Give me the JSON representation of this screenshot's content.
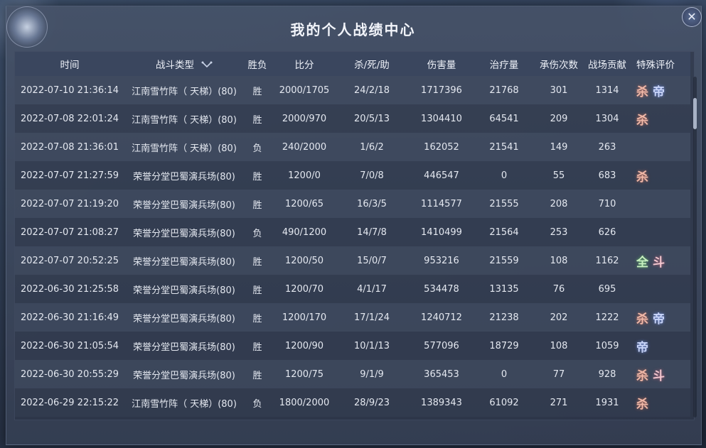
{
  "window": {
    "title": "我的个人战绩中心",
    "close_glyph": "✕"
  },
  "columns": [
    "时间",
    "战斗类型",
    "胜负",
    "比分",
    "杀/死/助",
    "伤害量",
    "治疗量",
    "承伤次数",
    "战场贡献",
    "特殊评价"
  ],
  "badge_labels": {
    "kill": "杀",
    "emperor": "帝",
    "all": "全",
    "fight": "斗"
  },
  "rows": [
    {
      "time": "2022-07-10 21:36:14",
      "type": "江南雪竹阵（ 天梯）(80)",
      "result": "胜",
      "score": "2000/1705",
      "kda": "24/2/18",
      "damage": "1717396",
      "heal": "21768",
      "hits": "301",
      "contrib": "1314",
      "badges": [
        "kill",
        "emperor"
      ]
    },
    {
      "time": "2022-07-08 22:01:24",
      "type": "江南雪竹阵（ 天梯）(80)",
      "result": "胜",
      "score": "2000/970",
      "kda": "20/5/13",
      "damage": "1304410",
      "heal": "64541",
      "hits": "209",
      "contrib": "1304",
      "badges": [
        "kill"
      ]
    },
    {
      "time": "2022-07-08 21:36:01",
      "type": "江南雪竹阵（ 天梯）(80)",
      "result": "负",
      "score": "240/2000",
      "kda": "1/6/2",
      "damage": "162052",
      "heal": "21541",
      "hits": "149",
      "contrib": "263",
      "badges": []
    },
    {
      "time": "2022-07-07 21:27:59",
      "type": "荣誉分堂巴蜀演兵场(80)",
      "result": "胜",
      "score": "1200/0",
      "kda": "7/0/8",
      "damage": "446547",
      "heal": "0",
      "hits": "55",
      "contrib": "683",
      "badges": [
        "kill"
      ]
    },
    {
      "time": "2022-07-07 21:19:20",
      "type": "荣誉分堂巴蜀演兵场(80)",
      "result": "胜",
      "score": "1200/65",
      "kda": "16/3/5",
      "damage": "1114577",
      "heal": "21555",
      "hits": "208",
      "contrib": "710",
      "badges": []
    },
    {
      "time": "2022-07-07 21:08:27",
      "type": "荣誉分堂巴蜀演兵场(80)",
      "result": "负",
      "score": "490/1200",
      "kda": "14/7/8",
      "damage": "1410499",
      "heal": "21564",
      "hits": "253",
      "contrib": "626",
      "badges": []
    },
    {
      "time": "2022-07-07 20:52:25",
      "type": "荣誉分堂巴蜀演兵场(80)",
      "result": "胜",
      "score": "1200/50",
      "kda": "15/0/7",
      "damage": "953216",
      "heal": "21559",
      "hits": "108",
      "contrib": "1162",
      "badges": [
        "all",
        "fight"
      ]
    },
    {
      "time": "2022-06-30 21:25:58",
      "type": "荣誉分堂巴蜀演兵场(80)",
      "result": "胜",
      "score": "1200/70",
      "kda": "4/1/17",
      "damage": "534478",
      "heal": "13135",
      "hits": "76",
      "contrib": "695",
      "badges": []
    },
    {
      "time": "2022-06-30 21:16:49",
      "type": "荣誉分堂巴蜀演兵场(80)",
      "result": "胜",
      "score": "1200/170",
      "kda": "17/1/24",
      "damage": "1240712",
      "heal": "21238",
      "hits": "202",
      "contrib": "1222",
      "badges": [
        "kill",
        "emperor"
      ]
    },
    {
      "time": "2022-06-30 21:05:54",
      "type": "荣誉分堂巴蜀演兵场(80)",
      "result": "胜",
      "score": "1200/90",
      "kda": "10/1/13",
      "damage": "577096",
      "heal": "18729",
      "hits": "108",
      "contrib": "1059",
      "badges": [
        "emperor"
      ]
    },
    {
      "time": "2022-06-30 20:55:29",
      "type": "荣誉分堂巴蜀演兵场(80)",
      "result": "胜",
      "score": "1200/75",
      "kda": "9/1/9",
      "damage": "365453",
      "heal": "0",
      "hits": "77",
      "contrib": "928",
      "badges": [
        "kill",
        "fight"
      ]
    },
    {
      "time": "2022-06-29 22:15:22",
      "type": "江南雪竹阵（ 天梯）(80)",
      "result": "负",
      "score": "1800/2000",
      "kda": "28/9/23",
      "damage": "1389343",
      "heal": "61092",
      "hits": "271",
      "contrib": "1931",
      "badges": [
        "kill"
      ]
    }
  ],
  "colors": {
    "kill": "#f0b8a8",
    "emperor": "#c8d4f8",
    "all": "#c8f0c0",
    "fight": "#f4c8d0"
  }
}
